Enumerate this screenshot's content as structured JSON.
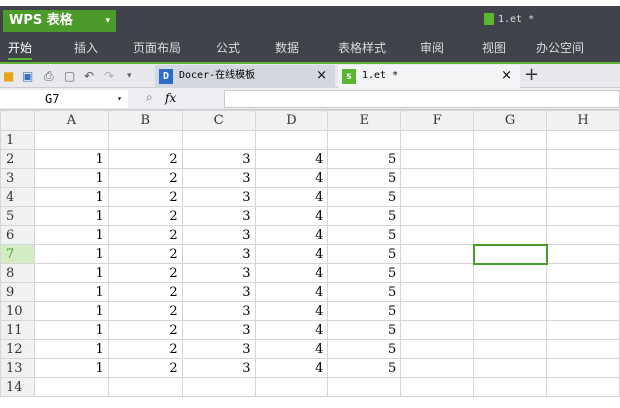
{
  "app": {
    "title": "WPS 表格",
    "doc_title": "1.et *"
  },
  "menu": [
    "开始",
    "插入",
    "页面布局",
    "公式",
    "数据",
    "表格样式",
    "审阅",
    "视图",
    "办公空间"
  ],
  "tabs": [
    {
      "label": "Docer-在线模板",
      "close": "×"
    },
    {
      "label": "1.et *",
      "close": "×"
    }
  ],
  "new_tab": "+",
  "formula_bar": {
    "name_box": "G7",
    "fx": "fx",
    "value": ""
  },
  "columns": [
    "A",
    "B",
    "C",
    "D",
    "E",
    "F",
    "G",
    "H"
  ],
  "rows": [
    {
      "n": "1",
      "cells": [
        "",
        "",
        "",
        "",
        "",
        "",
        "",
        ""
      ]
    },
    {
      "n": "2",
      "cells": [
        "1",
        "2",
        "3",
        "4",
        "5",
        "",
        "",
        ""
      ]
    },
    {
      "n": "3",
      "cells": [
        "1",
        "2",
        "3",
        "4",
        "5",
        "",
        "",
        ""
      ]
    },
    {
      "n": "4",
      "cells": [
        "1",
        "2",
        "3",
        "4",
        "5",
        "",
        "",
        ""
      ]
    },
    {
      "n": "5",
      "cells": [
        "1",
        "2",
        "3",
        "4",
        "5",
        "",
        "",
        ""
      ]
    },
    {
      "n": "6",
      "cells": [
        "1",
        "2",
        "3",
        "4",
        "5",
        "",
        "",
        ""
      ]
    },
    {
      "n": "7",
      "cells": [
        "1",
        "2",
        "3",
        "4",
        "5",
        "",
        "",
        ""
      ]
    },
    {
      "n": "8",
      "cells": [
        "1",
        "2",
        "3",
        "4",
        "5",
        "",
        "",
        ""
      ]
    },
    {
      "n": "9",
      "cells": [
        "1",
        "2",
        "3",
        "4",
        "5",
        "",
        "",
        ""
      ]
    },
    {
      "n": "10",
      "cells": [
        "1",
        "2",
        "3",
        "4",
        "5",
        "",
        "",
        ""
      ]
    },
    {
      "n": "11",
      "cells": [
        "1",
        "2",
        "3",
        "4",
        "5",
        "",
        "",
        ""
      ]
    },
    {
      "n": "12",
      "cells": [
        "1",
        "2",
        "3",
        "4",
        "5",
        "",
        "",
        ""
      ]
    },
    {
      "n": "13",
      "cells": [
        "1",
        "2",
        "3",
        "4",
        "5",
        "",
        "",
        ""
      ]
    },
    {
      "n": "14",
      "cells": [
        "",
        "",
        "",
        "",
        "",
        "",
        "",
        ""
      ]
    }
  ],
  "selected": {
    "row": "7",
    "col": "G"
  },
  "colors": {
    "accent": "#4b9a2a",
    "topbar": "#404349"
  }
}
